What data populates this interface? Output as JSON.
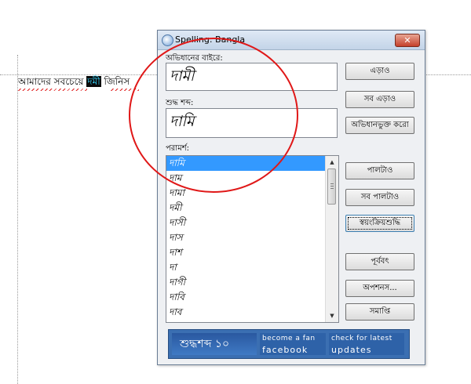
{
  "document": {
    "text_before": "আমাদের সবচেয়ে ",
    "misspelled_word": "দমী",
    "text_after": " জিনিস"
  },
  "dialog": {
    "title": "Spelling: Bangla",
    "close_symbol": "✕",
    "not_in_dictionary_label": "অভিধানের বাইরে:",
    "not_in_dictionary_value": "দামী",
    "correction_label": "শুদ্ধ শব্দ:",
    "correction_value": "দামি",
    "suggestions_label": "পরামর্শ:",
    "suggestions": [
      "দামি",
      "দাম",
      "দামা",
      "দমী",
      "দাসী",
      "দাস",
      "দাশ",
      "দা",
      "দাগী",
      "দাবি",
      "দাব"
    ],
    "selected_suggestion_index": 0,
    "buttons": {
      "ignore": "এড়াও",
      "ignore_all": "সব এড়াও",
      "add_to_dictionary": "অভিধানভুক্ত করো",
      "change": "পালটাও",
      "change_all": "সব পালটাও",
      "autocorrect": "স্বয়ংক্রিয়শুদ্ধি",
      "undo": "পূর্ববৎ",
      "options": "অপশনস...",
      "finish": "সমাপ্তি"
    },
    "banner": {
      "logo": "শুদ্ধশব্দ ১০",
      "fan_line1": "become a fan",
      "fan_line2": "facebook",
      "updates_line1": "check for latest",
      "updates_line2": "updates"
    }
  },
  "icons": {
    "scroll_up": "▲",
    "scroll_down": "▼"
  },
  "colors": {
    "selection": "#3399ff",
    "annotation_circle": "#e01818",
    "banner": "#3b6fb2"
  }
}
